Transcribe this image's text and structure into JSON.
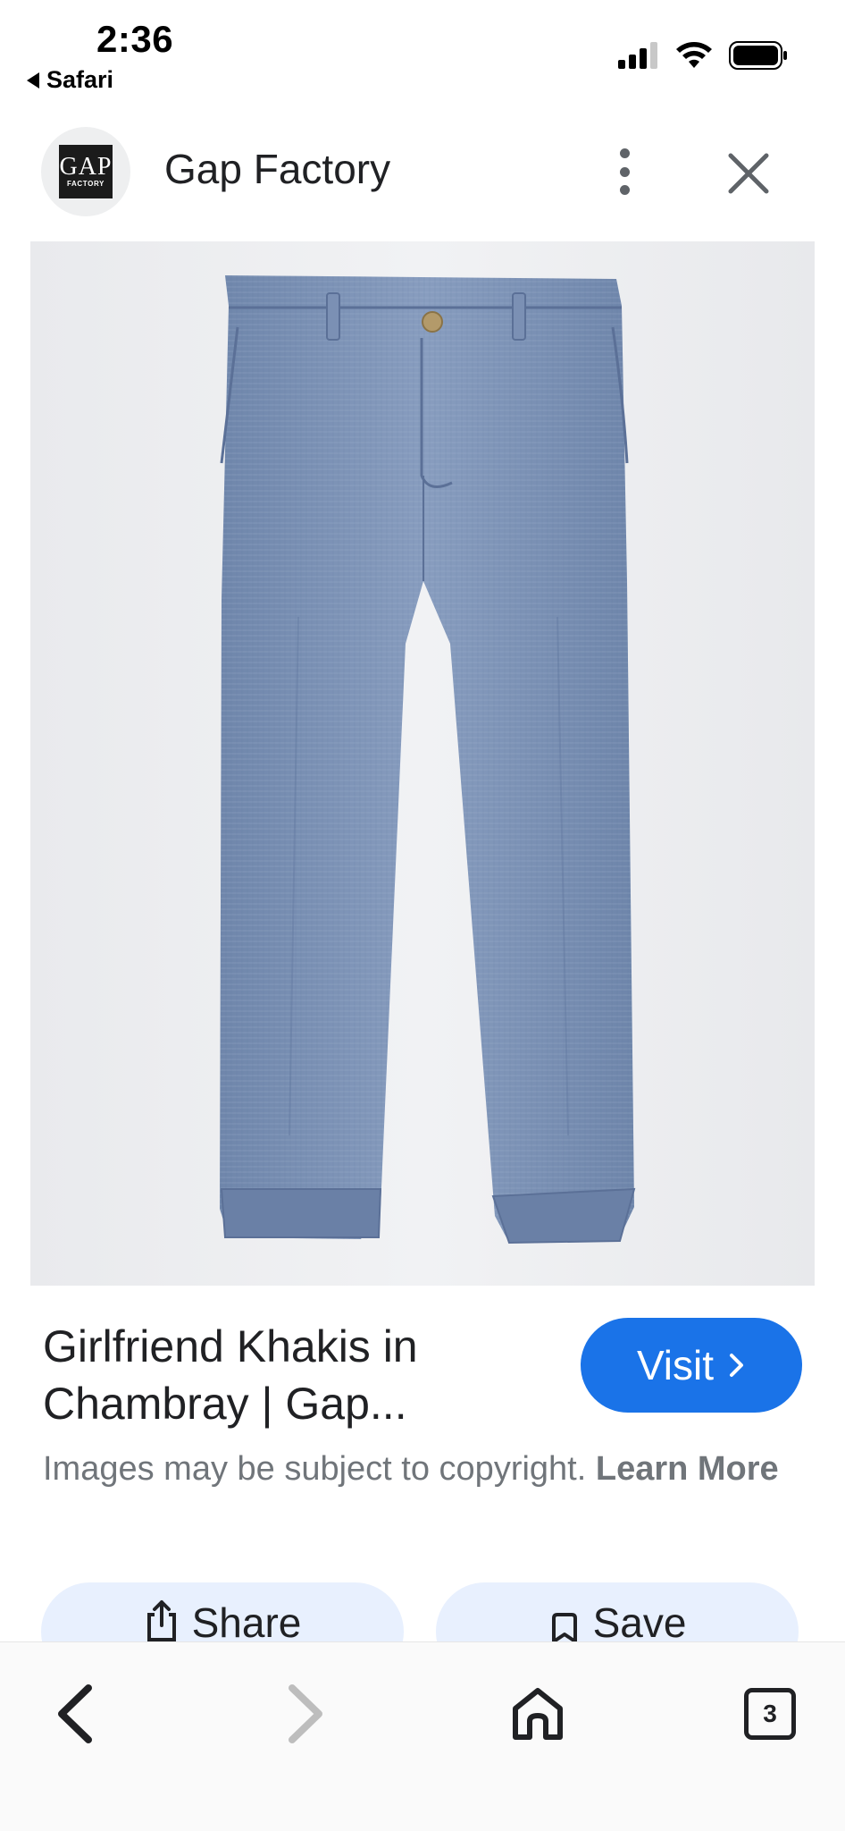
{
  "status_bar": {
    "time": "2:36",
    "back_app": "Safari"
  },
  "header": {
    "logo_text": "GAP",
    "logo_subtext": "FACTORY",
    "site_name": "Gap Factory"
  },
  "product": {
    "title": "Girlfriend Khakis in Chambray | Gap...",
    "visit_label": "Visit",
    "copyright_text": "Images may be subject to copyright.",
    "learn_more": "Learn More"
  },
  "actions": {
    "share_label": "Share",
    "save_label": "Save"
  },
  "bottom_bar": {
    "tabs_count": "3"
  },
  "colors": {
    "accent": "#1a73e8",
    "pill_bg": "#e8f0fe",
    "chambray": "#7d93b8"
  },
  "icons": [
    "signal-icon",
    "wifi-icon",
    "battery-icon",
    "more-vert-icon",
    "close-icon",
    "chevron-right-icon",
    "share-icon",
    "bookmark-icon",
    "back-icon",
    "forward-icon",
    "home-icon",
    "tabs-icon"
  ]
}
